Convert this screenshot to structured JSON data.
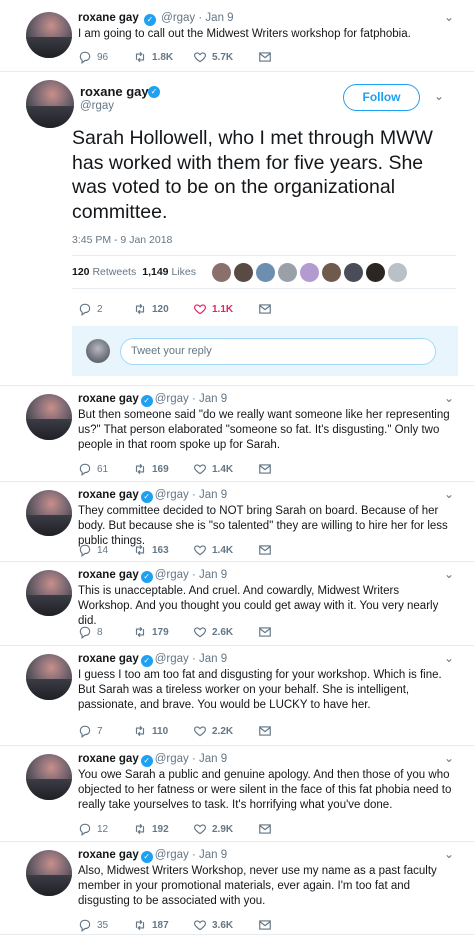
{
  "colors": {
    "accent": "#1da1f2",
    "like_active": "#e0245e",
    "muted": "#657786"
  },
  "author": {
    "name": "roxane gay",
    "handle": "@rgay"
  },
  "tweets": [
    {
      "date": "Jan 9",
      "text": "I am going to call out the Midwest Writers workshop for fatphobia.",
      "replies": "96",
      "retweets": "1.8K",
      "likes": "5.7K"
    },
    {
      "date": "Jan 9",
      "text": "But then someone said \"do we really want someone like her representing us?\" That person elaborated \"someone so fat. It's disgusting.\" Only two people in that room spoke up for Sarah.",
      "replies": "61",
      "retweets": "169",
      "likes": "1.4K"
    },
    {
      "date": "Jan 9",
      "text": "They committee decided to NOT bring Sarah on board. Because of her body. But because she is \"so talented\" they are willing to hire her for less public things.",
      "replies": "14",
      "retweets": "163",
      "likes": "1.4K"
    },
    {
      "date": "Jan 9",
      "text": "This is unacceptable. And cruel. And cowardly, Midwest Writers Workshop. And you thought you could get away with it. You very nearly did.",
      "replies": "8",
      "retweets": "179",
      "likes": "2.6K"
    },
    {
      "date": "Jan 9",
      "text": "I guess I too am too fat and disgusting for your workshop. Which is fine. But Sarah was a tireless worker on your behalf. She is intelligent, passionate, and brave. You would be LUCKY to have her.",
      "replies": "7",
      "retweets": "110",
      "likes": "2.2K"
    },
    {
      "date": "Jan 9",
      "text": "You owe Sarah a public and genuine apology. And then those of you who objected to her fatness or were silent in the face of this fat phobia need to really take yourselves to task. It's horrifying what you've done.",
      "replies": "12",
      "retweets": "192",
      "likes": "2.9K"
    },
    {
      "date": "Jan 9",
      "text": "Also, Midwest Writers Workshop, never use my name as a past faculty member in your promotional materials, ever again. I'm too fat and disgusting to be associated with you.",
      "replies": "35",
      "retweets": "187",
      "likes": "3.6K"
    }
  ],
  "main_tweet": {
    "follow_label": "Follow",
    "text": "Sarah Hollowell, who I met through MWW has worked with them for five years. She was voted to be on the organizational committee.",
    "timestamp": "3:45 PM - 9 Jan 2018",
    "retweets_count": "120",
    "retweets_label": "Retweets",
    "likes_count": "1,149",
    "likes_label": "Likes",
    "replies": "2",
    "retweets": "120",
    "likes": "1.1K"
  },
  "reply_placeholder": "Tweet your reply"
}
